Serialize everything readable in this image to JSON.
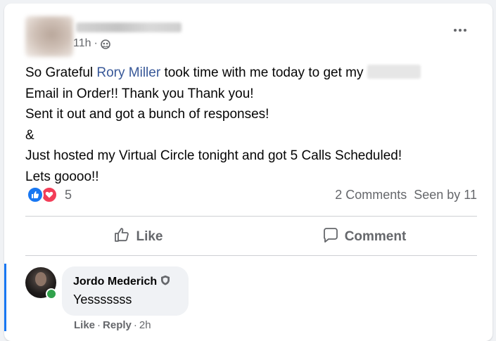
{
  "post": {
    "time": "11h",
    "separator": "·",
    "privacy_icon": "friends-privacy-icon",
    "text": {
      "part1": "So Grateful ",
      "mention": "Rory Miller",
      "part2": " took time with me today to get my ",
      "line2": "Email in Order!! Thank you Thank you!",
      "line3": "Sent it out and got a bunch of responses!",
      "line4": "&",
      "line5": "Just hosted my Virtual Circle tonight and got 5 Calls Scheduled!",
      "line6": "Lets goooo!!"
    },
    "reaction_count": "5",
    "comments_count": "2 Comments",
    "seen_by": "Seen by 11"
  },
  "actions": {
    "like_label": "Like",
    "comment_label": "Comment"
  },
  "comment": {
    "author": "Jordo Mederich",
    "text": "Yesssssss",
    "like_label": "Like",
    "dot": "·",
    "reply_label": "Reply",
    "time": "2h"
  },
  "colors": {
    "mention": "#385898",
    "like_blue": "#1877f2",
    "love_red": "#f33e58",
    "online_green": "#31a24c",
    "thread_bar": "#1877f2"
  }
}
